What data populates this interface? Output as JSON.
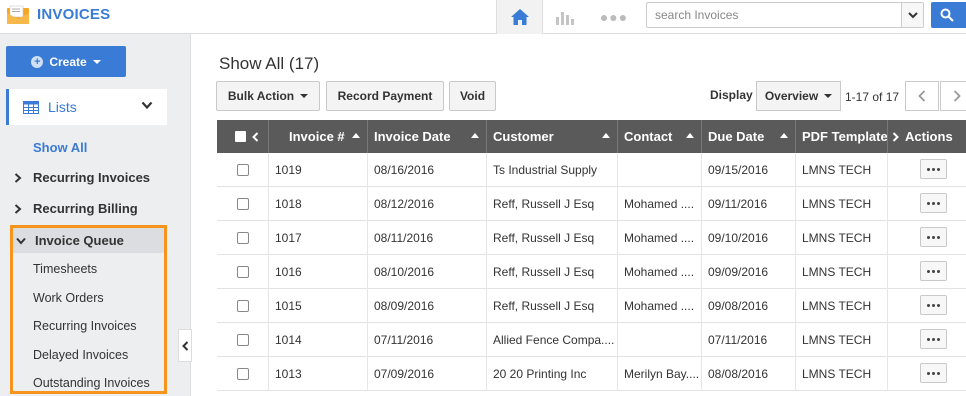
{
  "app": {
    "title": "INVOICES"
  },
  "search": {
    "placeholder": "search Invoices"
  },
  "sidebar": {
    "create_label": "Create",
    "lists_label": "Lists",
    "show_all": "Show All",
    "groups": [
      {
        "label": "Recurring Invoices"
      },
      {
        "label": "Recurring Billing"
      }
    ],
    "queue": {
      "label": "Invoice Queue",
      "items": [
        "Timesheets",
        "Work Orders",
        "Recurring Invoices",
        "Delayed Invoices",
        "Outstanding Invoices"
      ]
    }
  },
  "main": {
    "title": "Show All (17)",
    "toolbar": {
      "bulk_action": "Bulk Action",
      "record_payment": "Record Payment",
      "void": "Void",
      "display_label": "Display",
      "display_value": "Overview",
      "paging": "1-17 of 17"
    }
  },
  "table": {
    "columns": [
      "Invoice #",
      "Invoice Date",
      "Customer",
      "Contact",
      "Due Date",
      "PDF Template",
      "Actions"
    ],
    "rows": [
      {
        "invoice": "1019",
        "date": "08/16/2016",
        "customer": "Ts Industrial Supply",
        "contact": "",
        "due": "09/15/2016",
        "pdf": "LMNS TECH"
      },
      {
        "invoice": "1018",
        "date": "08/12/2016",
        "customer": "Reff, Russell J Esq",
        "contact": "Mohamed ....",
        "due": "09/11/2016",
        "pdf": "LMNS TECH"
      },
      {
        "invoice": "1017",
        "date": "08/11/2016",
        "customer": "Reff, Russell J Esq",
        "contact": "Mohamed ....",
        "due": "09/10/2016",
        "pdf": "LMNS TECH"
      },
      {
        "invoice": "1016",
        "date": "08/10/2016",
        "customer": "Reff, Russell J Esq",
        "contact": "Mohamed ....",
        "due": "09/09/2016",
        "pdf": "LMNS TECH"
      },
      {
        "invoice": "1015",
        "date": "08/09/2016",
        "customer": "Reff, Russell J Esq",
        "contact": "Mohamed ....",
        "due": "09/08/2016",
        "pdf": "LMNS TECH"
      },
      {
        "invoice": "1014",
        "date": "07/11/2016",
        "customer": "Allied Fence Compa....",
        "contact": "",
        "due": "07/11/2016",
        "pdf": "LMNS TECH"
      },
      {
        "invoice": "1013",
        "date": "07/09/2016",
        "customer": "20 20 Printing Inc",
        "contact": "Merilyn Bay....",
        "due": "08/08/2016",
        "pdf": "LMNS TECH"
      }
    ]
  },
  "colors": {
    "accent": "#3a7bd5",
    "highlight": "#f7941d",
    "header": "#5a5a5a"
  },
  "icons": [
    "invoice-logo-icon",
    "home-icon",
    "bar-chart-icon",
    "more-icon",
    "chevron-down-icon",
    "search-icon",
    "plus-icon",
    "list-icon",
    "chevron-right-icon",
    "chevron-left-icon",
    "sort-up-icon",
    "ellipsis-icon"
  ]
}
